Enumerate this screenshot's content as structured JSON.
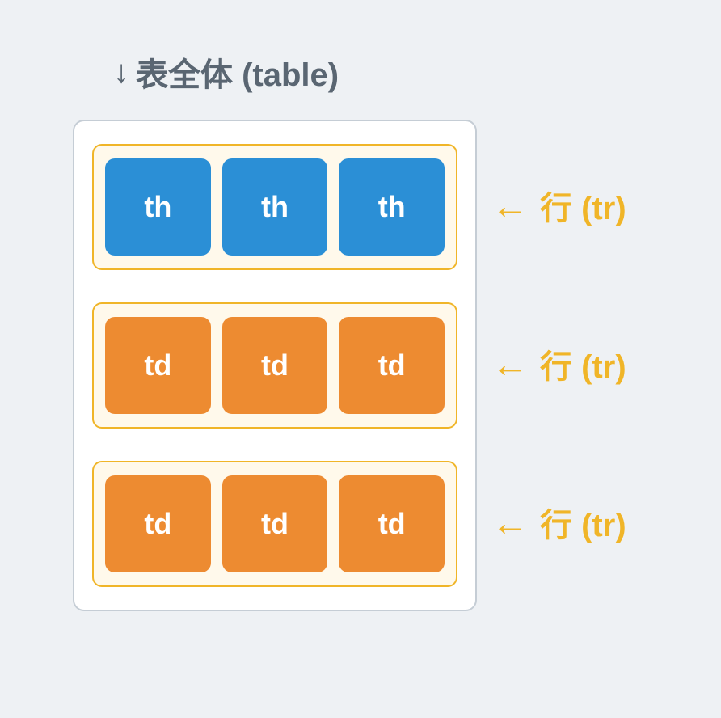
{
  "title": {
    "arrow": "↓",
    "text": "表全体 (table)"
  },
  "rows": [
    {
      "cells": [
        "th",
        "th",
        "th"
      ],
      "type": "th",
      "label": "行 (tr)"
    },
    {
      "cells": [
        "td",
        "td",
        "td"
      ],
      "type": "td",
      "label": "行 (tr)"
    },
    {
      "cells": [
        "td",
        "td",
        "td"
      ],
      "type": "td",
      "label": "行 (tr)"
    }
  ],
  "arrow_left": "←"
}
